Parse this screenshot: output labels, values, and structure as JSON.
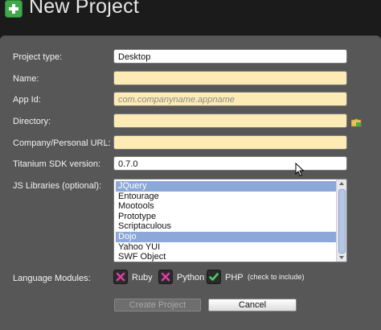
{
  "window": {
    "title": "New Project"
  },
  "form": {
    "project_type": {
      "label": "Project type:",
      "value": "Desktop"
    },
    "name": {
      "label": "Name:",
      "value": ""
    },
    "app_id": {
      "label": "App Id:",
      "placeholder": "com.companyname.appname"
    },
    "directory": {
      "label": "Directory:",
      "value": ""
    },
    "company_url": {
      "label": "Company/Personal URL:",
      "value": ""
    },
    "sdk_version": {
      "label": "Titanium SDK version:",
      "value": "0.7.0"
    },
    "js_libraries": {
      "label": "JS Libraries (optional):",
      "items": [
        {
          "label": "JQuery",
          "selected": true
        },
        {
          "label": "Entourage",
          "selected": false
        },
        {
          "label": "Mootools",
          "selected": false
        },
        {
          "label": "Prototype",
          "selected": false
        },
        {
          "label": "Scriptaculous",
          "selected": false
        },
        {
          "label": "Dojo",
          "selected": true
        },
        {
          "label": "Yahoo YUI",
          "selected": false
        },
        {
          "label": "SWF Object",
          "selected": false
        }
      ]
    },
    "language_modules": {
      "label": "Language Modules:",
      "modules": [
        {
          "label": "Ruby",
          "checked": false
        },
        {
          "label": "Python",
          "checked": false
        },
        {
          "label": "PHP",
          "checked": true
        }
      ],
      "hint": "(check to include)"
    }
  },
  "buttons": {
    "create": "Create Project",
    "cancel": "Cancel"
  },
  "colors": {
    "background": "#1b1b1b",
    "panel": "#575757",
    "required_field": "#fcebb5",
    "selection": "#8ca8d8",
    "checked_icon": "#49d05c",
    "unchecked_icon": "#e03aa8",
    "title_icon": "#3fa94c"
  },
  "icons": {
    "title": "plus-icon",
    "directory": "folder-icon",
    "checked": "checkmark-icon",
    "unchecked": "x-mark-icon"
  }
}
